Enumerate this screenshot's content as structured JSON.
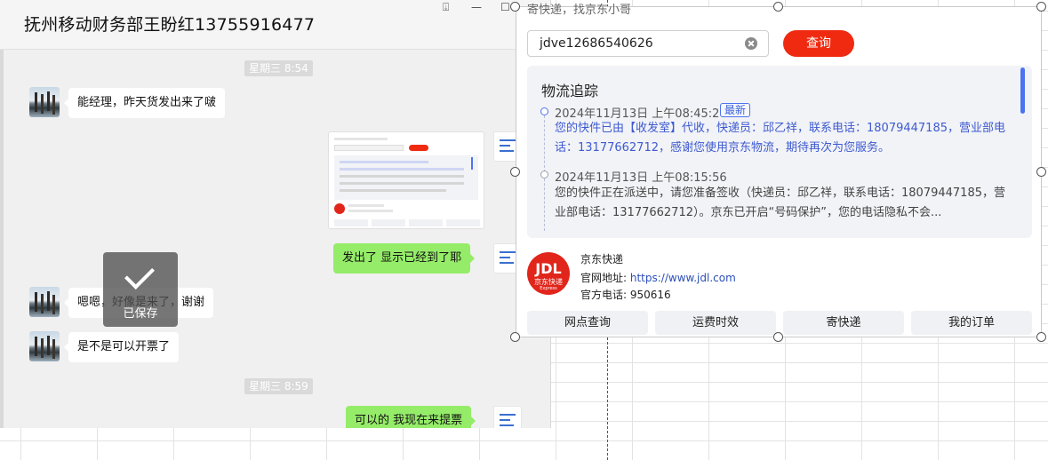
{
  "chat": {
    "title": "抚州移动财务部王盼红13755916477",
    "window_controls": [
      "⍗",
      "—",
      "☐"
    ],
    "times": [
      "星期三 8:54",
      "星期三 8:59"
    ],
    "messages": [
      {
        "side": "left",
        "text": "能经理，昨天货发出来了啵"
      },
      {
        "side": "right",
        "text": "发出了  显示已经到了耶"
      },
      {
        "side": "left",
        "text": "嗯嗯，好像是来了，谢谢"
      },
      {
        "side": "left",
        "text": "是不是可以开票了"
      },
      {
        "side": "right",
        "text": "可以的  我现在来提票"
      }
    ],
    "saved_toast": "已保存"
  },
  "courier": {
    "top_text": "寄快递，找京东小哥",
    "tracking_number": "jdve12686540626",
    "query_label": "查询",
    "section_title": "物流追踪",
    "events": [
      {
        "time": "2024年11月13日 上午08:45:26",
        "badge": "最新",
        "text": "您的快件已由【收发室】代收，快递员：邱乙祥，联系电话：18079447185，营业部电话：13177662712，感谢您使用京东物流，期待再次为您服务。"
      },
      {
        "time": "2024年11月13日 上午08:15:56",
        "badge": "",
        "text": "您的快件正在派送中，请您准备签收（快递员：邱乙祥，联系电话：18079447185，营业部电话：13177662712）。京东已开启“号码保护”，您的电话隐私不会..."
      }
    ],
    "company": {
      "logo_mark": "JDL",
      "logo_sub": "京东快递",
      "logo_small": "Express",
      "name": "京东快递",
      "site_label": "官网地址: ",
      "site_url": "https://www.jdl.com",
      "phone_label": "官方电话:  950616"
    },
    "actions": [
      "网点查询",
      "运费时效",
      "寄快递",
      "我的订单"
    ]
  },
  "colors": {
    "accent_red": "#f02a10",
    "accent_blue": "#4d74f0",
    "chat_green": "#95ec69"
  }
}
